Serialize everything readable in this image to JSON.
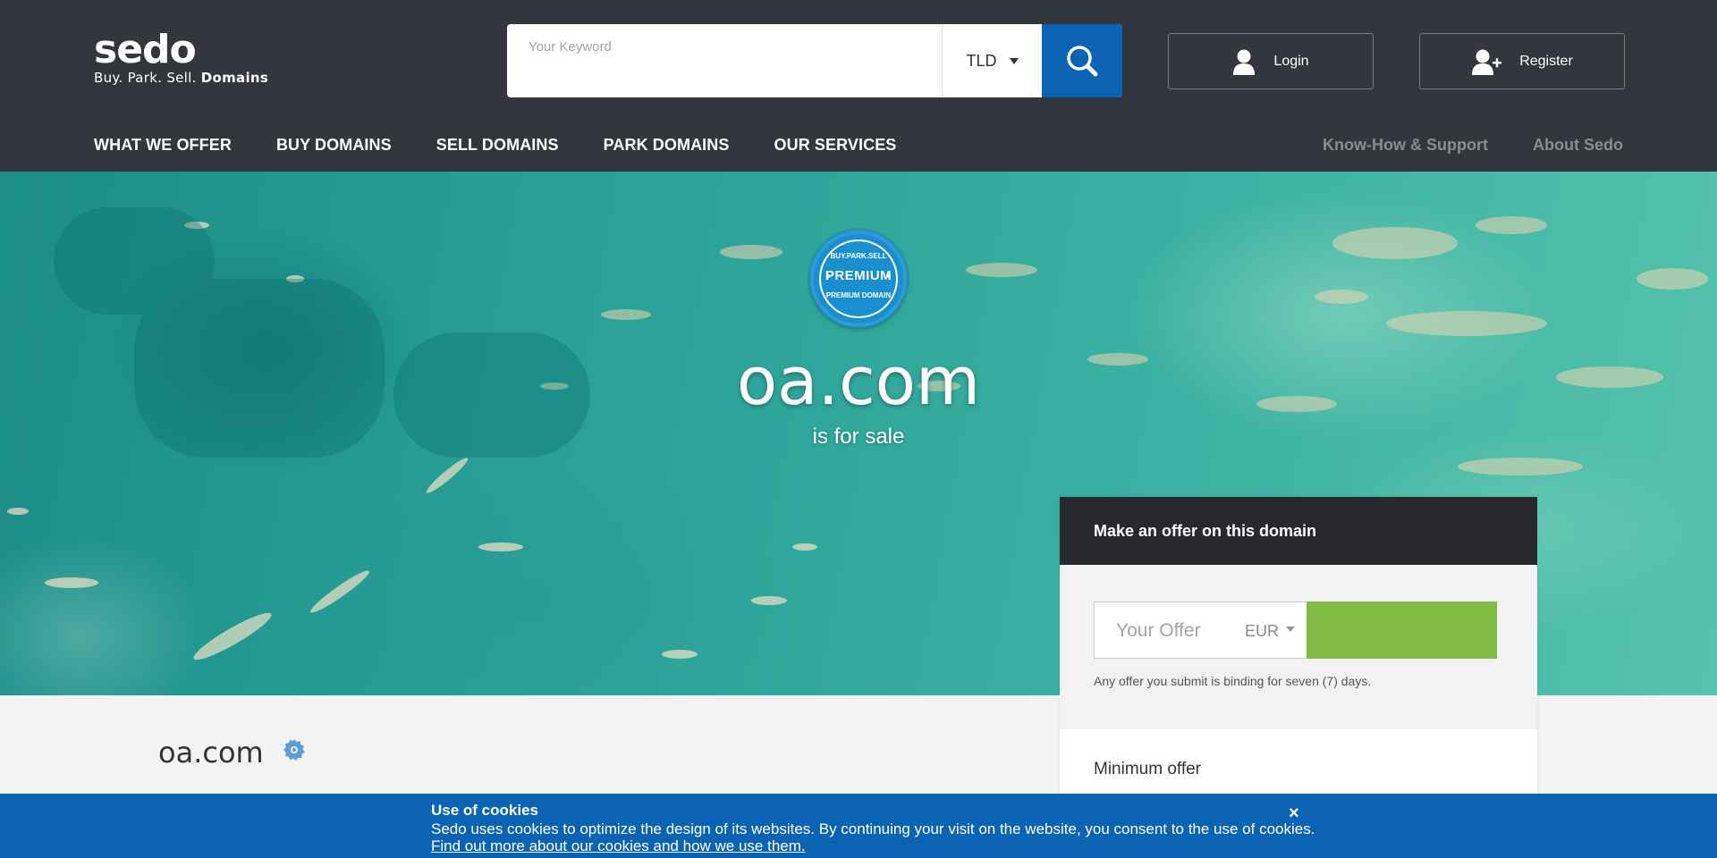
{
  "header": {
    "logo": {
      "name": "sedo",
      "tagline_prefix": "Buy. Park. Sell.",
      "tagline_bold": "Domains"
    },
    "search": {
      "placeholder": "Your Keyword",
      "tld_label": "TLD"
    },
    "login_label": "Login",
    "register_label": "Register",
    "nav": [
      "WHAT WE OFFER",
      "BUY DOMAINS",
      "SELL DOMAINS",
      "PARK DOMAINS",
      "OUR SERVICES"
    ],
    "nav_right": [
      "Know-How & Support",
      "About Sedo"
    ]
  },
  "hero": {
    "badge": {
      "top": "BUY.PARK.SELL",
      "center": "PREMIUM",
      "bottom": "PREMIUM DOMAIN"
    },
    "domain": "oa.com",
    "subtitle": "is for sale"
  },
  "content": {
    "domain": "oa.com"
  },
  "offer": {
    "title": "Make an offer on this domain",
    "input_placeholder": "Your Offer",
    "currency": "EUR",
    "note": "Any offer you submit is binding for seven (7) days.",
    "minimum_label": "Minimum offer"
  },
  "cookie": {
    "title": "Use of cookies",
    "text": "Sedo uses cookies to optimize the design of its websites. By continuing your visit on the website, you consent to the use of cookies.",
    "link": "Find out more about our cookies and how we use them.",
    "close": "×"
  },
  "colors": {
    "header_bg": "#33363d",
    "brand_blue": "#0a63b3",
    "offer_green": "#82bb44",
    "offer_head_bg": "#27292d"
  }
}
